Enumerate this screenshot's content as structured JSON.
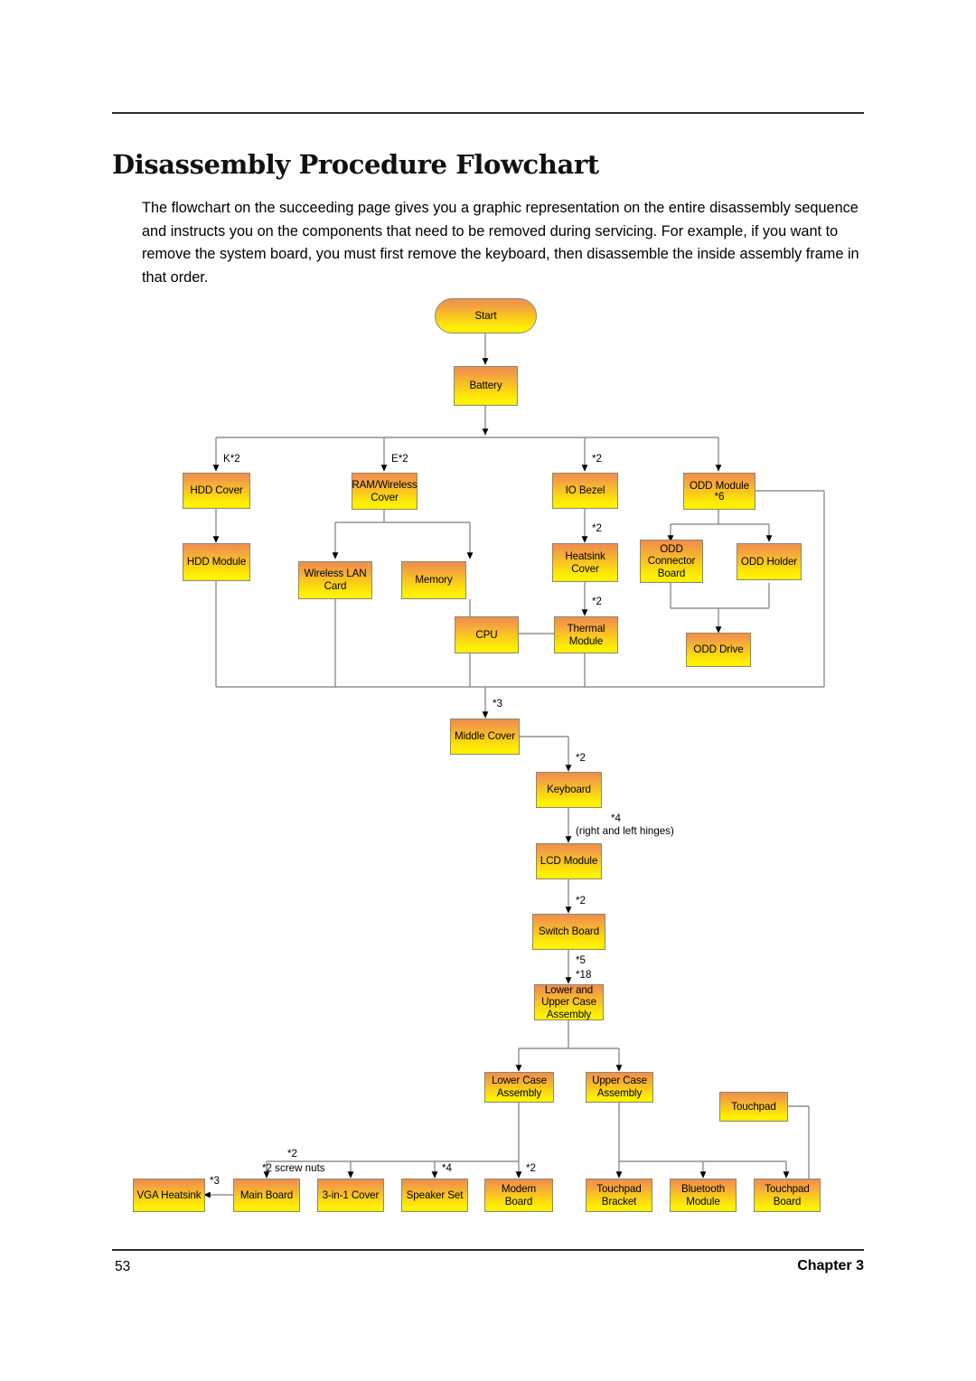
{
  "document": {
    "title": "Disassembly Procedure Flowchart",
    "intro": "The flowchart on the succeeding page gives you a graphic representation on the entire disassembly sequence and instructs you on the components that need to be removed during servicing. For example, if you want to remove the system board, you must first remove the keyboard, then disassemble the inside assembly frame in that order.",
    "footer": {
      "page_number": "53",
      "chapter": "Chapter 3"
    }
  },
  "flowchart": {
    "type": "diagram",
    "style": {
      "node_fill_top": "#ef8d4f",
      "node_fill_bottom": "#ffee00",
      "node_border": "#8a8a6e",
      "connector_color": "#808080"
    },
    "nodes": [
      {
        "id": "start",
        "label": "Start",
        "shape": "pill"
      },
      {
        "id": "battery",
        "label": "Battery",
        "shape": "rect"
      },
      {
        "id": "hdd_cover",
        "label": "HDD Cover",
        "shape": "rect"
      },
      {
        "id": "hdd_module",
        "label": "HDD Module",
        "shape": "rect"
      },
      {
        "id": "ram_cover",
        "label": "RAM/Wireless Cover",
        "shape": "rect"
      },
      {
        "id": "wlan_card",
        "label": "Wireless LAN Card",
        "shape": "rect"
      },
      {
        "id": "memory",
        "label": "Memory",
        "shape": "rect"
      },
      {
        "id": "io_bezel",
        "label": "IO Bezel",
        "shape": "rect"
      },
      {
        "id": "heatsink_cover",
        "label": "Heatsink Cover",
        "shape": "rect"
      },
      {
        "id": "cpu",
        "label": "CPU",
        "shape": "rect"
      },
      {
        "id": "thermal_module",
        "label": "Thermal Module",
        "shape": "rect"
      },
      {
        "id": "odd_module",
        "label": "ODD Module",
        "sublabel": "*6",
        "shape": "rect"
      },
      {
        "id": "odd_conn_board",
        "label": "ODD Connector Board",
        "shape": "rect"
      },
      {
        "id": "odd_holder",
        "label": "ODD Holder",
        "shape": "rect"
      },
      {
        "id": "odd_drive",
        "label": "ODD Drive",
        "shape": "rect"
      },
      {
        "id": "middle_cover",
        "label": "Middle Cover",
        "shape": "rect"
      },
      {
        "id": "keyboard",
        "label": "Keyboard",
        "shape": "rect"
      },
      {
        "id": "lcd_module",
        "label": "LCD Module",
        "shape": "rect"
      },
      {
        "id": "switch_board",
        "label": "Switch Board",
        "shape": "rect"
      },
      {
        "id": "lower_upper",
        "label": "Lower and Upper Case Assembly",
        "shape": "rect"
      },
      {
        "id": "lower_case",
        "label": "Lower Case Assembly",
        "shape": "rect"
      },
      {
        "id": "upper_case",
        "label": "Upper Case Assembly",
        "shape": "rect"
      },
      {
        "id": "touchpad",
        "label": "Touchpad",
        "shape": "rect"
      },
      {
        "id": "vga_heatsink",
        "label": "VGA Heatsink",
        "shape": "rect"
      },
      {
        "id": "main_board",
        "label": "Main Board",
        "shape": "rect"
      },
      {
        "id": "three_in_one",
        "label": "3-in-1 Cover",
        "shape": "rect"
      },
      {
        "id": "speaker_set",
        "label": "Speaker Set",
        "shape": "rect"
      },
      {
        "id": "modem_board",
        "label": "Modem Board",
        "shape": "rect"
      },
      {
        "id": "tp_bracket",
        "label": "Touchpad Bracket",
        "shape": "rect"
      },
      {
        "id": "bt_module",
        "label": "Bluetooth Module",
        "shape": "rect"
      },
      {
        "id": "tp_board",
        "label": "Touchpad Board",
        "shape": "rect"
      }
    ],
    "edge_labels": {
      "hdd_cover": "K*2",
      "ram_cover": "E*2",
      "io_bezel": "*2",
      "heatsink_cover": "*2",
      "thermal_module": "*2",
      "middle_cover": "*3",
      "keyboard": "*2",
      "lcd_module_a": "*4",
      "lcd_module_b": "(right and left hinges)",
      "switch_board": "*2",
      "lower_upper_a": "*5",
      "lower_upper_b": "*18",
      "main_board_a": "*2",
      "main_board_b": "*2 screw nuts",
      "vga_heatsink": "*3",
      "three_in_one": "*4",
      "speaker_set": "*2",
      "modem_board": "*2"
    }
  }
}
